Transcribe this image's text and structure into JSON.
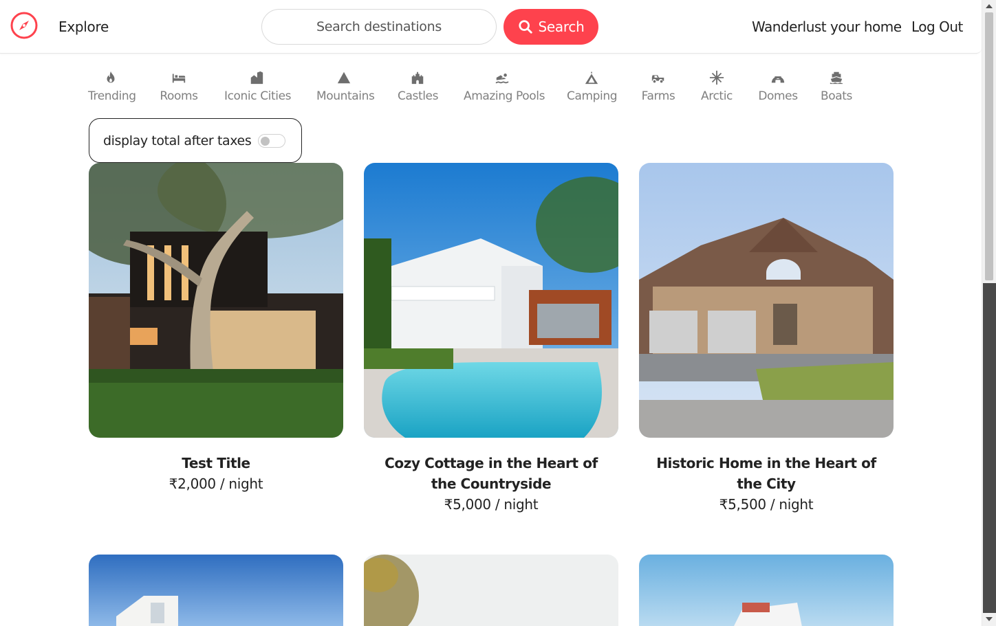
{
  "colors": {
    "brand": "#fe424d",
    "text": "#222222",
    "muted": "#6a6a6a"
  },
  "navbar": {
    "logo_icon": "compass-icon",
    "explore": "Explore",
    "search": {
      "placeholder": "Search destinations",
      "button_label": "Search",
      "button_icon": "search-icon"
    },
    "home_link": "Wanderlust your home",
    "logout": "Log Out"
  },
  "filters": [
    {
      "label": "Trending",
      "icon": "fire-icon"
    },
    {
      "label": "Rooms",
      "icon": "bed-icon"
    },
    {
      "label": "Iconic Cities",
      "icon": "city-icon"
    },
    {
      "label": "Mountains",
      "icon": "mountain-icon"
    },
    {
      "label": "Castles",
      "icon": "castle-icon"
    },
    {
      "label": "Amazing Pools",
      "icon": "swimmer-icon"
    },
    {
      "label": "Camping",
      "icon": "tent-icon"
    },
    {
      "label": "Farms",
      "icon": "tractor-icon"
    },
    {
      "label": "Arctic",
      "icon": "snowflake-icon"
    },
    {
      "label": "Domes",
      "icon": "igloo-icon"
    },
    {
      "label": "Boats",
      "icon": "ship-icon"
    }
  ],
  "tax_toggle": {
    "label": "display total after taxes",
    "checked": false
  },
  "listings": [
    {
      "title": "Test Title",
      "price": "₹2,000",
      "per": " / night"
    },
    {
      "title": "Cozy Cottage in the Heart of the Countryside",
      "price": "₹5,000",
      "per": " / night"
    },
    {
      "title": "Historic Home in the Heart of the City",
      "price": "₹5,500",
      "per": " / night"
    }
  ]
}
